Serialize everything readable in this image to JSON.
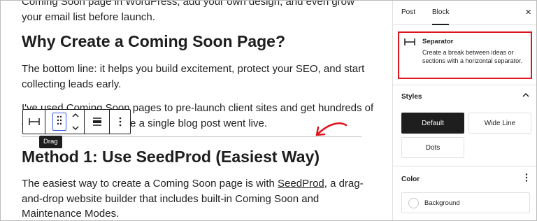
{
  "editor": {
    "para_top": "Coming Soon page in WordPress, add your own design, and even grow your email list before launch.",
    "heading1": "Why Create a Coming Soon Page?",
    "para1": "The bottom line: it helps you build excitement, protect your SEO, and start collecting leads early.",
    "para2": "I've used Coming Soon pages to pre-launch client sites and get hundreds of email subscribers before a single blog post went live.",
    "heading2": "Method 1: Use SeedProd (Easiest Way)",
    "para3_before": "The easiest way to create a Coming Soon page is with ",
    "para3_link": "SeedProd",
    "para3_after": ", a drag-and-drop website builder that includes built-in Coming Soon and Maintenance Modes."
  },
  "toolbar": {
    "drag_tooltip": "Drag",
    "icons": [
      "separator-icon",
      "drag-handle-icon",
      "chevron-up-icon",
      "chevron-down-icon",
      "align-icon",
      "more-options-icon"
    ]
  },
  "sidebar": {
    "tabs": [
      {
        "label": "Post"
      },
      {
        "label": "Block"
      }
    ],
    "active_tab": "Block",
    "close_label": "×",
    "block_card": {
      "title": "Separator",
      "description": "Create a break between ideas or sections with a horizontal separator."
    },
    "styles": {
      "title": "Styles",
      "options": [
        {
          "label": "Default"
        },
        {
          "label": "Wide Line"
        },
        {
          "label": "Dots"
        }
      ],
      "selected": "Default"
    },
    "color": {
      "title": "Color",
      "background_label": "Background"
    }
  },
  "colors": {
    "highlight": "#e0141c",
    "annotation_arrow": "#e0141c",
    "drag_focus": "#3858e9",
    "selected_style_bg": "#1e1e1e"
  }
}
